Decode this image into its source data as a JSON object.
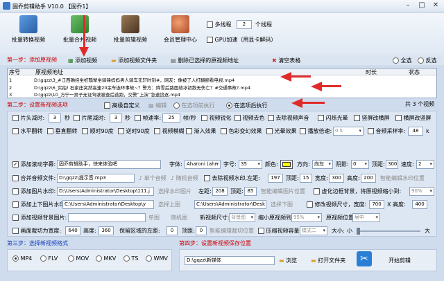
{
  "app": {
    "title": "固乔剪辑助手 V10.0 【固乔1】"
  },
  "toolbar": {
    "items": [
      {
        "label": "批量转换视频",
        "icon": "convert-icon",
        "color": "#3a6fb5"
      },
      {
        "label": "批量合并视频",
        "icon": "merge-icon",
        "color": "#3b9a3b"
      },
      {
        "label": "批量剪辑视频",
        "icon": "film-icon",
        "color": "#6b4a2a"
      },
      {
        "label": "会员管理中心",
        "icon": "users-icon",
        "color": "#c45a3a"
      }
    ],
    "multithread": {
      "label": "多线程",
      "value": "2",
      "unit": "个线程"
    },
    "gpu": {
      "label": "GPU加速（用显卡解码）"
    }
  },
  "step1": {
    "title": "第一步：添加原视频",
    "add_video": "添加视频",
    "add_folder": "添加视频文件夹",
    "delete_selected": "删除已选择的原视频地址",
    "clear": "清空表格",
    "select_all": "全选",
    "invert": "反选"
  },
  "table": {
    "columns": [
      "序号",
      "原视频地址",
      "时长",
      "状态"
    ],
    "rows": [
      {
        "no": "1",
        "path": "D:\\gqzz\\3_#江西确挂坐桩瓢辇坐骑锋妈妈男人骑车无轩时刻#，网友：像被了人打翻额看电视.mp4"
      },
      {
        "no": "2",
        "path": "D:\\gqzz\\6_实拍! 石家庄突然高速20余车连环事故~？警方：降雪后路面结冰初散无伤亡？#交通事故?.mp4"
      },
      {
        "no": "3",
        "path": "D:\\gqzz\\10_万宁一男子无证驾驶被查后逃跑，交警“上演”急速追逐.mp4"
      }
    ],
    "total": "共 3 个视频"
  },
  "step2": {
    "title": "第二步：设置新视频选项",
    "advanced": "高级自定义",
    "edit": "编辑",
    "before_exec": "在选项前执行",
    "after_exec": "在选项后执行"
  },
  "opts": {
    "head_cut": "片头减时:",
    "head_val": "3",
    "sec": "秒",
    "tail_cut": "片尾减时:",
    "tail_val": "3",
    "sec2": "秒",
    "fps": "帧速率:",
    "fps_val": "25",
    "fps_unit": "帧/秒",
    "o1": "视频锐化",
    "o2": "视频去色",
    "o3": "去除视频声音",
    "o4": "闪烁光晕",
    "o5": "竖屏改横屏",
    "o6": "横屏改竖屏",
    "h_flip": "水平翻转",
    "v_flip": "垂直翻转",
    "cw90": "顺时90度",
    "ccw90": "逆时90度",
    "o7": "视频模糊",
    "o8": "渐入效果",
    "o9": "色彩变幻效果",
    "o10": "光晕效果",
    "speed": "播放倍速:",
    "speed_val": "0.5",
    "sample": "音频采样率:",
    "sample_val": "48",
    "k": "k",
    "subtitle": "添加滚动字幕:",
    "subtitle_val": "固乔剪辑助手，快来体验吧",
    "font": "字体:",
    "font_val": "Aharoni (ahr:",
    "size": "字号:",
    "size_val": "35",
    "color": "颜色:",
    "dir": "方向:",
    "dir_val": "向左",
    "shadow": "阴影:",
    "shadow_val": "0",
    "top": "顶距:",
    "top_val": "300",
    "speed2": "速度:",
    "speed2_val": "2",
    "audio": "合并音频文件:",
    "audio_val": "D:\\gqzz\\提示音.mp3",
    "single_audio": "单个音频",
    "random_audio": "随机音频",
    "remove_wm": "去除视频水印,左距:",
    "rw_left": "197",
    "rw_top": "顶距:",
    "rw_top_val": "15",
    "rw_w": "宽度:",
    "rw_w_val": "300",
    "rw_h": "高度:",
    "rw_h_val": "200",
    "smart_wm": "智能编辑水印位置",
    "pic_wm": "添加图片水印:",
    "pic_wm_val": "D:\\Users\\Administrator\\Desktop\\111.j",
    "pic_wm_pos": "选择水印图片",
    "pw_left": "左距:",
    "pw_left_val": "208",
    "pw_top": "顶距:",
    "pw_top_val": "85",
    "smart_pic": "智能编辑图片位置",
    "vblur": "虚化边框背景，将原视频缩小到:",
    "vblur_val": "90%",
    "tb_pic": "添加上下图片水印:",
    "tb_top": "C:\\Users\\Administrator\\Desktop\\y",
    "tb_top_btn": "选择上图",
    "tb_bot": "C:\\Users\\Administrator\\Desk",
    "tb_bot_btn": "选择下图",
    "resize": "修改视频尺寸，宽度:",
    "resize_w": "700",
    "resize_h_lbl": "X 高度:",
    "resize_h": "400",
    "bg": "添加视频背景图片:",
    "single_pic": "单图",
    "random_pic": "随机图",
    "new_pos": "新视频尺寸:",
    "new_pos_val": "背景图",
    "shrink": "缩小原视频到:",
    "shrink_val": "95%",
    "orig_pos": "原视频位置:",
    "orig_pos_val": "居中",
    "crop": "画面裁切为宽度:",
    "crop_w": "640",
    "crop_h_lbl": "高度:",
    "crop_h": "360",
    "crop_left": "保留区域的左距:",
    "crop_left_val": "0",
    "crop_top": "顶距:",
    "crop_top_val": "0",
    "smart_crop": "智能编辑裁切位置",
    "compress": "压缩视频容量",
    "mode": "模式二",
    "size_lbl": "大小:",
    "small": "小",
    "big": "大"
  },
  "step3": {
    "title": "第三步：选择新视频格式",
    "formats": [
      "MP4",
      "FLV",
      "MOV",
      "MKV",
      "TS",
      "WMV"
    ]
  },
  "step4": {
    "title": "第四步：设置新视频保存位置",
    "path": "D:\\gqzz\\新媒体",
    "browse": "浏览",
    "open_folder": "打开文件夹",
    "start": "开始剪辑"
  },
  "colors": {
    "accent_red": "#e02a2a",
    "section": "#c00000",
    "subtitle_color": "#ffff00"
  }
}
